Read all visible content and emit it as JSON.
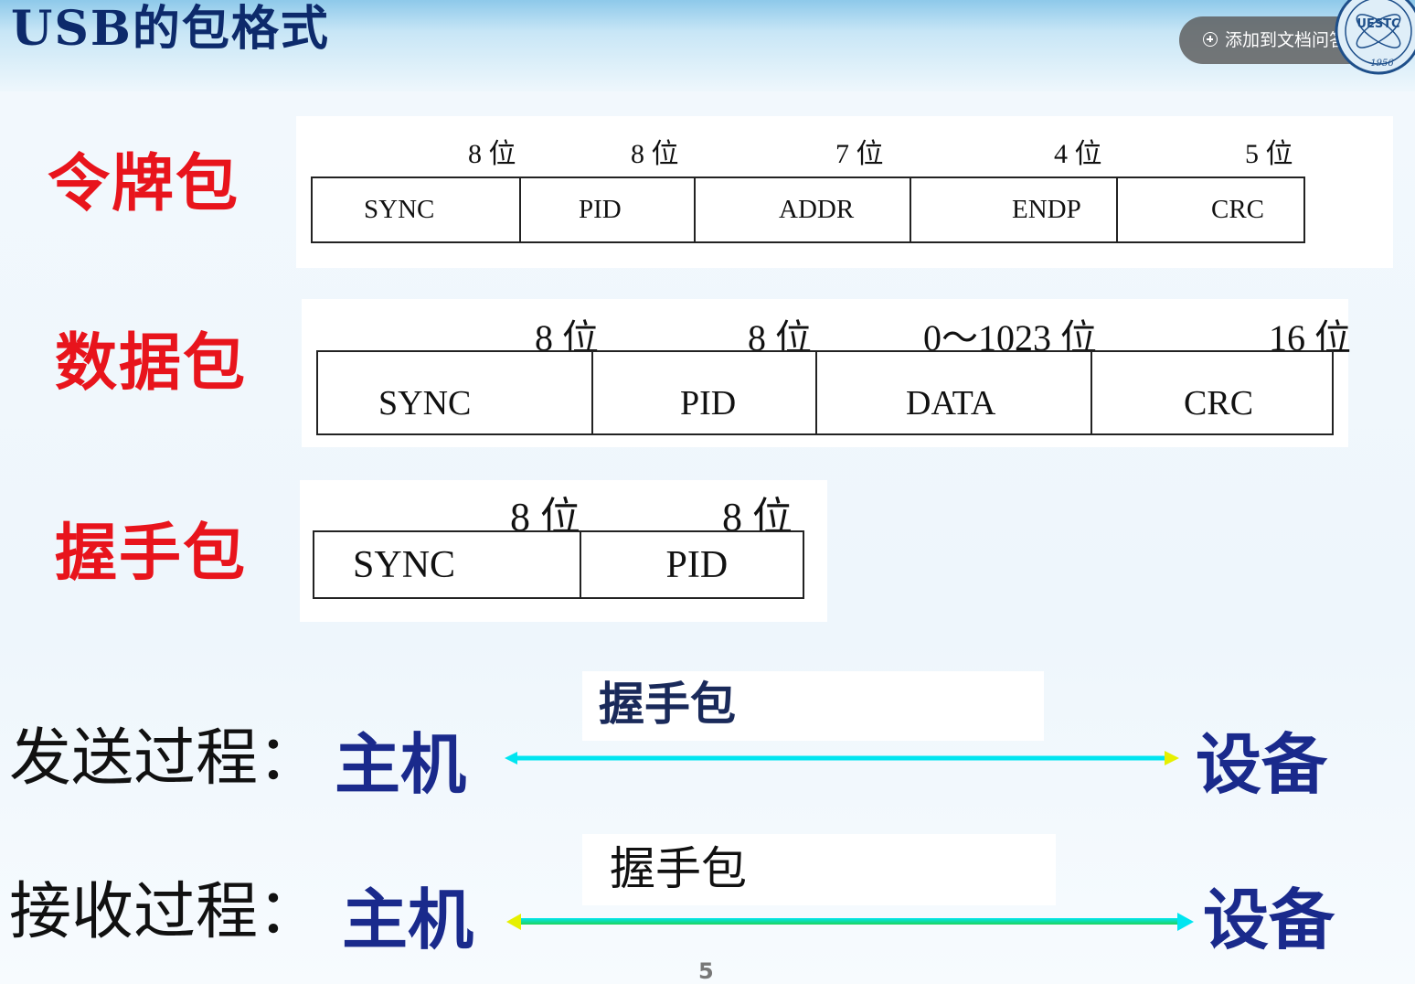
{
  "slide": {
    "title": "USB的包格式",
    "page_number": "5"
  },
  "overlay": {
    "add_button_label": "添加到文档问答",
    "logo_text": "UESTC",
    "logo_year": "1956"
  },
  "token_packet": {
    "label": "令牌包",
    "bits": [
      "8 位",
      "8 位",
      "7 位",
      "4 位",
      "5 位"
    ],
    "fields": [
      "SYNC",
      "PID",
      "ADDR",
      "ENDP",
      "CRC"
    ]
  },
  "data_packet": {
    "label": "数据包",
    "bits": [
      "8 位",
      "8 位",
      "0～1023 位",
      "16 位"
    ],
    "fields": [
      "SYNC",
      "PID",
      "DATA",
      "CRC"
    ]
  },
  "handshake_packet": {
    "label": "握手包",
    "bits": [
      "8 位",
      "8 位"
    ],
    "fields": [
      "SYNC",
      "PID"
    ]
  },
  "send_process": {
    "label": "发送过程：",
    "host": "主机",
    "device": "设备",
    "caption": "握手包",
    "direction": "host-to-device"
  },
  "receive_process": {
    "label": "接收过程：",
    "host": "主机",
    "device": "设备",
    "caption": "握手包",
    "direction": "device-to-host"
  },
  "colors": {
    "title": "#0d2a6b",
    "packet_label": "#e8141c",
    "host_device": "#1a2a8c",
    "send_caption": "#1a2a5a",
    "receive_caption": "#111111",
    "arrow_cyan": "#00e5f0",
    "arrow_green": "#1fd35a",
    "arrow_tip": "#e6f000"
  }
}
